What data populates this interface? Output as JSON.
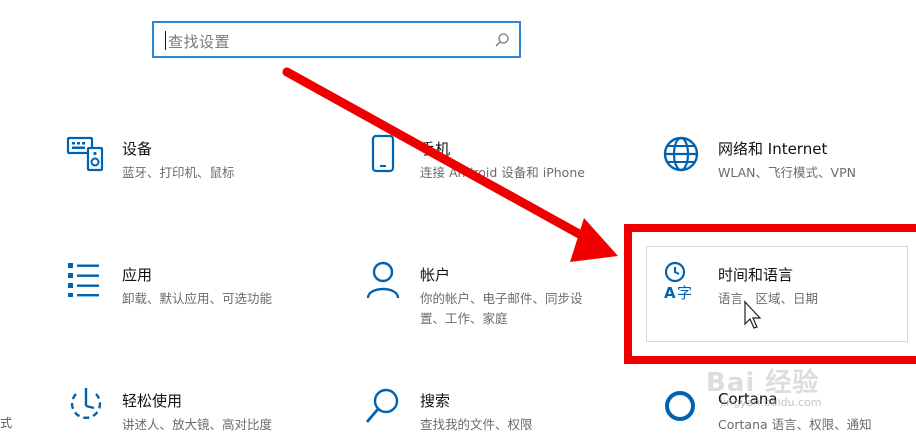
{
  "search": {
    "placeholder": "查找设置",
    "icon": "search-icon"
  },
  "tiles": [
    {
      "title": "设备",
      "desc": "蓝牙、打印机、鼠标",
      "icon": "device-keyboard-speaker-icon"
    },
    {
      "title": "手机",
      "desc": "连接 Android 设备和 iPhone",
      "icon": "phone-icon"
    },
    {
      "title": "网络和 Internet",
      "desc": "WLAN、飞行模式、VPN",
      "icon": "globe-icon"
    },
    {
      "title": "应用",
      "desc": "卸载、默认应用、可选功能",
      "icon": "apps-list-icon"
    },
    {
      "title": "帐户",
      "desc_line1": "你的帐户、电子邮件、同步设",
      "desc_line2": "置、工作、家庭",
      "icon": "person-icon"
    },
    {
      "title": "时间和语言",
      "desc": "语言、区域、日期",
      "icon": "time-language-icon"
    },
    {
      "title": "轻松使用",
      "desc": "讲述人、放大镜、高对比度",
      "icon": "ease-of-access-icon"
    },
    {
      "title": "搜索",
      "desc": "查找我的文件、权限",
      "icon": "magnifier-icon"
    },
    {
      "title": "Cortana",
      "desc": "Cortana 语言、权限、通知",
      "icon": "cortana-ring-icon"
    }
  ],
  "annotation": {
    "color": "#ee0000"
  },
  "watermark": {
    "brand": "Bai 经验",
    "url": "jingyan.baidu.com"
  },
  "edge_text": "式",
  "colors": {
    "accent": "#0063b1",
    "search_border": "#2e86d6"
  }
}
